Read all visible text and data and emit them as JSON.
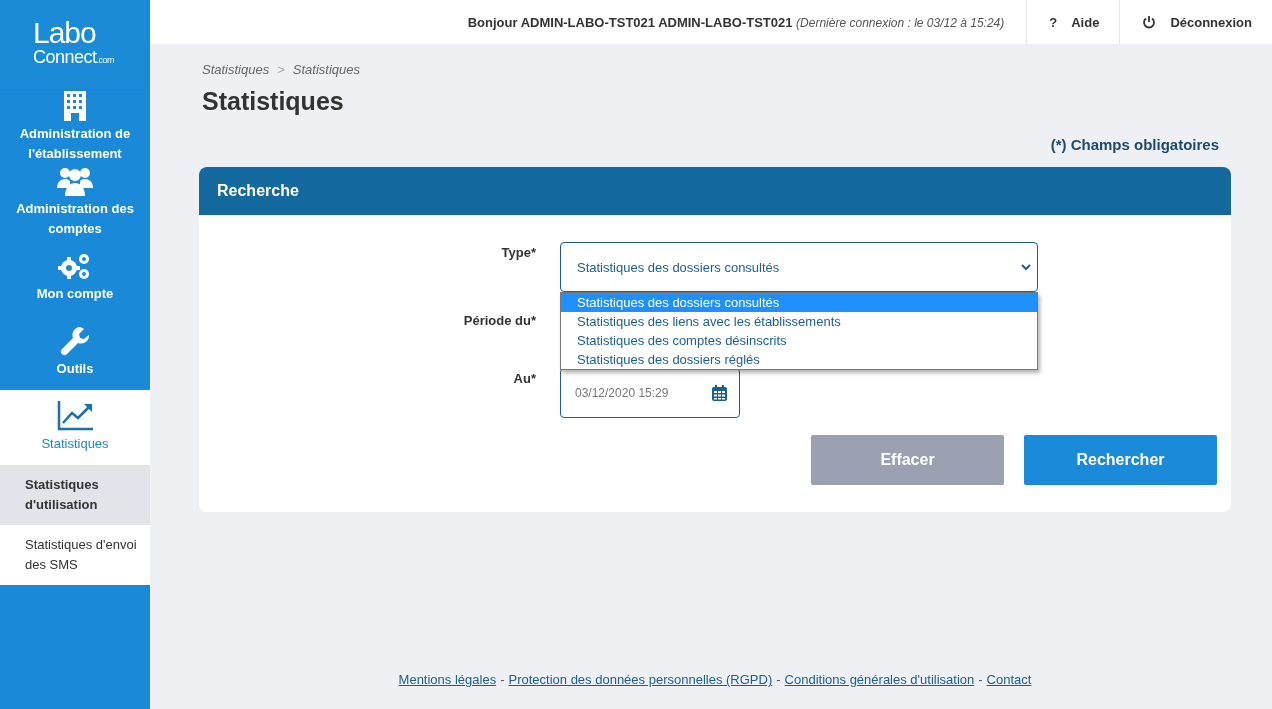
{
  "logo": {
    "line1": "Labo",
    "line2": "Connect",
    "suffix": ".com"
  },
  "sidebar": {
    "items": [
      {
        "kind": "building",
        "label": "Administration de l'établissement",
        "selected": false
      },
      {
        "kind": "users",
        "label": "Administration des comptes",
        "selected": false
      },
      {
        "kind": "gears",
        "label": "Mon compte",
        "selected": false
      },
      {
        "kind": "wrench",
        "label": "Outils",
        "selected": false
      },
      {
        "kind": "chart",
        "label": "Statistiques",
        "selected": true
      }
    ],
    "subitems": [
      {
        "label": "Statistiques d'utilisation",
        "selected": true
      },
      {
        "label": "Statistiques d'envoi des SMS",
        "selected": false
      }
    ]
  },
  "header": {
    "greeting": "Bonjour ADMIN-LABO-TST021 ADMIN-LABO-TST021",
    "last_login": "(Dernière connexion : le 03/12 à 15:24)",
    "help": {
      "icon": "?",
      "label": "Aide"
    },
    "logout": "Déconnexion"
  },
  "breadcrumb": [
    "Statistiques",
    "Statistiques"
  ],
  "breadcrumb_separator": ">",
  "title": "Statistiques",
  "required_note": "(*) Champs obligatoires",
  "panel": {
    "title": "Recherche",
    "type_label": "Type*",
    "type_value": "Statistiques des dossiers consultés",
    "options": [
      {
        "label": "Statistiques des dossiers consultés",
        "selected": true
      },
      {
        "label": "Statistiques des liens avec les établissements",
        "selected": false
      },
      {
        "label": "Statistiques des comptes désinscrits",
        "selected": false
      },
      {
        "label": "Statistiques des dossiers réglés",
        "selected": false
      }
    ],
    "period_label": "Période du*",
    "to_label": "Au*",
    "to_value": "03/12/2020 15:29",
    "clear_button": {
      "label": "Effacer",
      "disabled": true
    },
    "search_button": "Rechercher"
  },
  "footer": {
    "links": [
      "Mentions légales",
      "Protection des données personnelles (RGPD)",
      "Conditions générales d'utilisation",
      "Contact"
    ],
    "separator": "-"
  }
}
